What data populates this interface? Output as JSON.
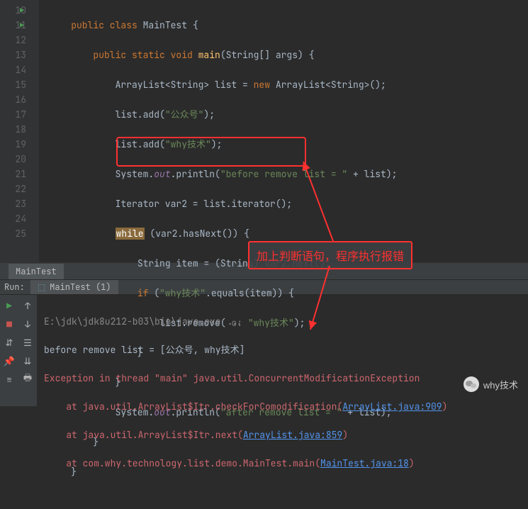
{
  "editor": {
    "lines": [
      10,
      11,
      12,
      13,
      14,
      15,
      16,
      17,
      18,
      19,
      20,
      21,
      22,
      23,
      24,
      25
    ],
    "code": {
      "l10": {
        "indent": "    ",
        "kw": "public class",
        "cls": " MainTest {"
      },
      "l11": {
        "indent": "        ",
        "kw1": "public static void",
        "mtd": " main",
        "sig": "(String[] args) {"
      },
      "l12": {
        "indent": "            ",
        "txt1": "ArrayList<String> list = ",
        "kw": "new",
        "txt2": " ArrayList<String>();"
      },
      "l13": {
        "indent": "            ",
        "call": "list.add(",
        "str": "\"公众号\"",
        "end": ");"
      },
      "l14": {
        "indent": "            ",
        "call": "list.add(",
        "str": "\"why技术\"",
        "end": ");"
      },
      "l15": {
        "indent": "            ",
        "obj": "System.",
        "fld": "out",
        "call": ".println(",
        "str": "\"before remove list = \"",
        "plus": " + list);"
      },
      "l16": {
        "indent": "            ",
        "txt": "Iterator var2 = list.iterator();"
      },
      "l17": {
        "indent": "            ",
        "kw": "while",
        "cond": " (var2.hasNext()) {"
      },
      "l18": {
        "indent": "                ",
        "txt": "String item = (String) var2.next();"
      },
      "l19": {
        "indent": "                ",
        "kw": "if",
        "open": " (",
        "str": "\"why技术\"",
        "call": ".equals(item)) {"
      },
      "l20": {
        "indent": "                    ",
        "call": "list.remove(",
        "hint": " o: ",
        "str": "\"why技术\"",
        "end": ");"
      },
      "l21": {
        "indent": "                ",
        "brace": "}"
      },
      "l22": {
        "indent": "            ",
        "brace": "}"
      },
      "l23": {
        "indent": "            ",
        "obj": "System.",
        "fld": "out",
        "call": ".println(",
        "str": "\"after remove list = \"",
        "plus": " + list);"
      },
      "l24": {
        "indent": "        ",
        "brace": "}"
      },
      "l25": {
        "indent": "    ",
        "brace": "}"
      }
    }
  },
  "tab": {
    "label": "MainTest"
  },
  "run": {
    "label": "Run:",
    "tab": "MainTest (1)"
  },
  "console": {
    "l1": "E:\\jdk\\jdk8u212-b03\\bin\\java.exe ...",
    "l2": "before remove list = [公众号, why技术]",
    "l3a": "Exception in thread \"main\" ",
    "l3b": "java.util.ConcurrentModificationException",
    "l4a": "    at java.util.ArrayList$Itr.checkForComodification(",
    "l4b": "ArrayList.java:909",
    "l4c": ")",
    "l5a": "    at java.util.ArrayList$Itr.next(",
    "l5b": "ArrayList.java:859",
    "l5c": ")",
    "l6a": "    at com.why.technology.list.demo.MainTest.main(",
    "l6b": "MainTest.java:18",
    "l6c": ")"
  },
  "annotation": {
    "text": "加上判断语句，程序执行报错"
  },
  "watermark": {
    "text": "why技术"
  }
}
